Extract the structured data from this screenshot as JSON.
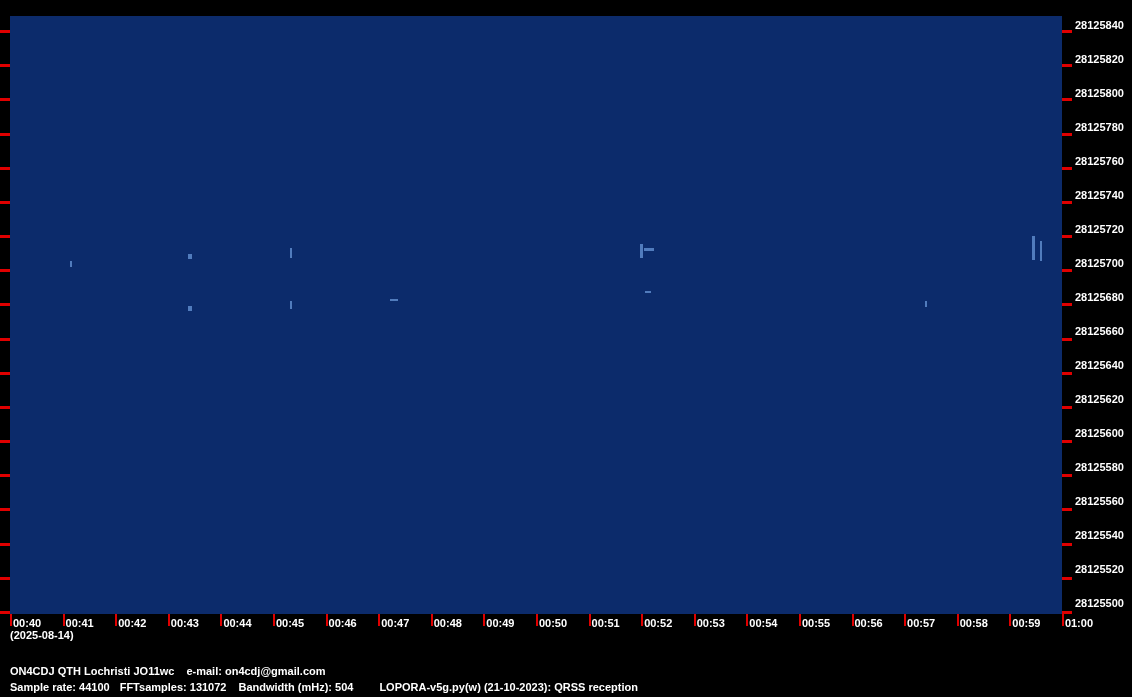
{
  "frequency_axis": {
    "labels": [
      "28125840",
      "28125820",
      "28125800",
      "28125780",
      "28125760",
      "28125740",
      "28125720",
      "28125700",
      "28125680",
      "28125660",
      "28125640",
      "28125620",
      "28125600",
      "28125580",
      "28125560",
      "28125540",
      "28125520",
      "28125500"
    ]
  },
  "time_axis": {
    "labels": [
      "00:40",
      "00:41",
      "00:42",
      "00:43",
      "00:44",
      "00:45",
      "00:46",
      "00:47",
      "00:48",
      "00:49",
      "00:50",
      "00:51",
      "00:52",
      "00:53",
      "00:54",
      "00:55",
      "00:56",
      "00:57",
      "00:58",
      "00:59",
      "01:00"
    ],
    "date": "(2025-08-14)"
  },
  "info_lines": [
    [
      "ON4CDJ QTH Lochristi JO11wc",
      "e-mail: on4cdj@gmail.com"
    ],
    [
      "Sample rate: 44100",
      "FFTsamples: 131072",
      "Bandwidth (mHz): 504",
      "LOPORA-v5g.py(w) (21-10-2023): QRSS reception"
    ]
  ]
}
